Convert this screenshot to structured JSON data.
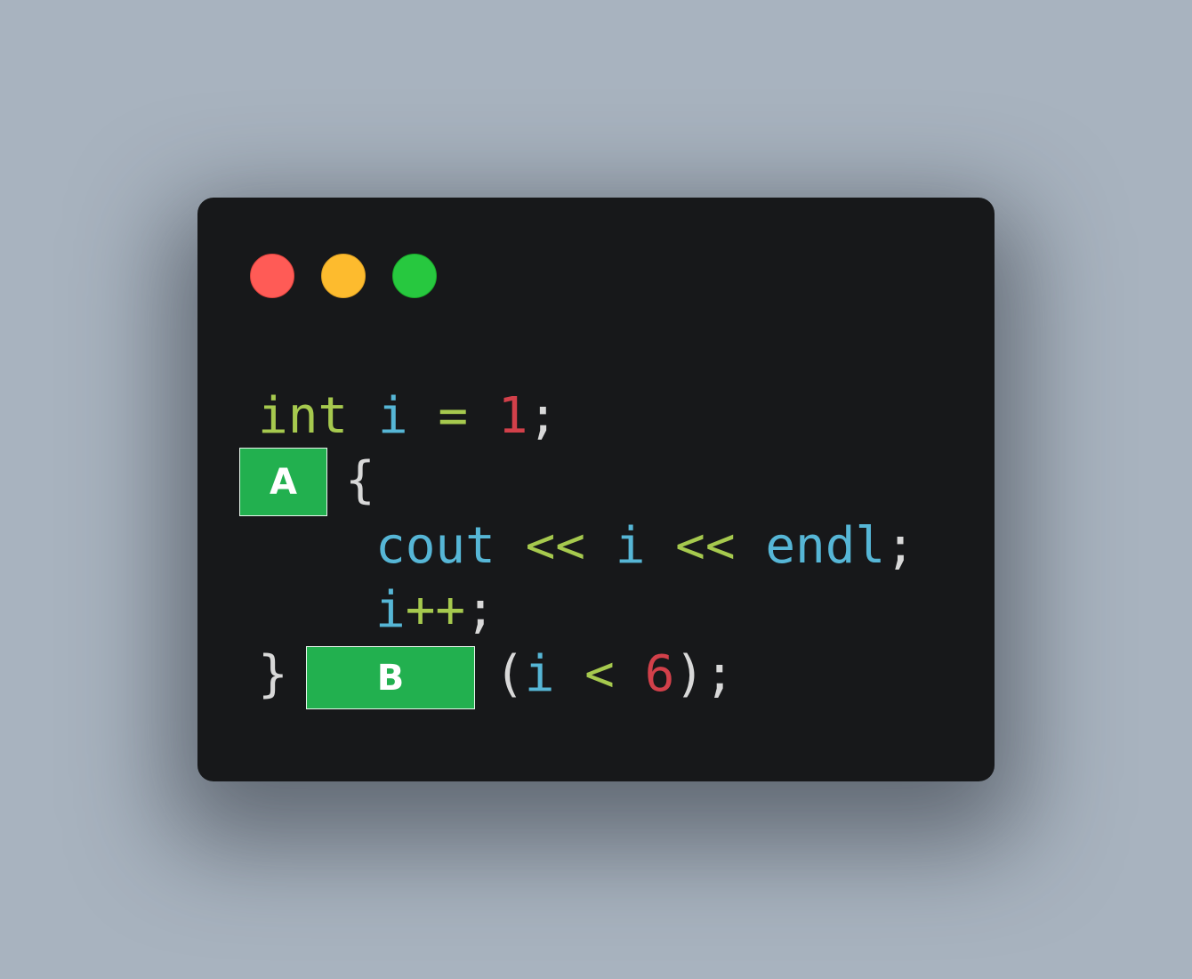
{
  "window_controls": {
    "red": "#ff5b56",
    "yellow": "#fdbb2e",
    "green": "#27c83f"
  },
  "code": {
    "line1": {
      "type": "int",
      "var": "i",
      "eq": "=",
      "value": "1",
      "semi": ";"
    },
    "line2": {
      "brace": "{"
    },
    "line3": {
      "cout": "cout",
      "op1": "<<",
      "var": "i",
      "op2": "<<",
      "endl": "endl",
      "semi": ";"
    },
    "line4": {
      "var": "i",
      "inc": "++",
      "semi": ";"
    },
    "line5": {
      "brace": "}",
      "lparen": "(",
      "var": "i",
      "lt": "<",
      "value": "6",
      "rparen": ")",
      "semi": ";"
    }
  },
  "blanks": {
    "a": "A",
    "b": "B"
  }
}
